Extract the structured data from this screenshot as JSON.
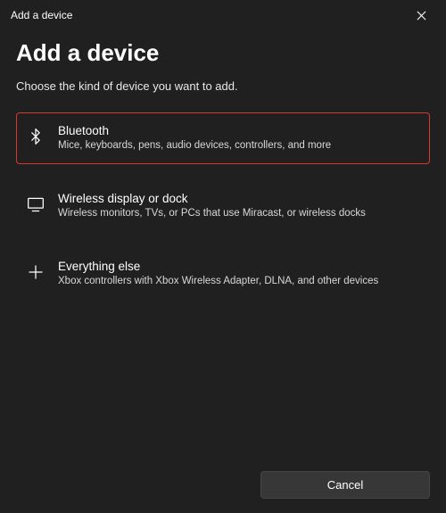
{
  "titlebar": {
    "title": "Add a device"
  },
  "main": {
    "heading": "Add a device",
    "subheading": "Choose the kind of device you want to add."
  },
  "options": {
    "bluetooth": {
      "title": "Bluetooth",
      "desc": "Mice, keyboards, pens, audio devices, controllers, and more"
    },
    "wireless": {
      "title": "Wireless display or dock",
      "desc": "Wireless monitors, TVs, or PCs that use Miracast, or wireless docks"
    },
    "other": {
      "title": "Everything else",
      "desc": "Xbox controllers with Xbox Wireless Adapter, DLNA, and other devices"
    }
  },
  "footer": {
    "cancel_label": "Cancel"
  },
  "colors": {
    "highlight_border": "#d33a2c",
    "background": "#202020"
  }
}
